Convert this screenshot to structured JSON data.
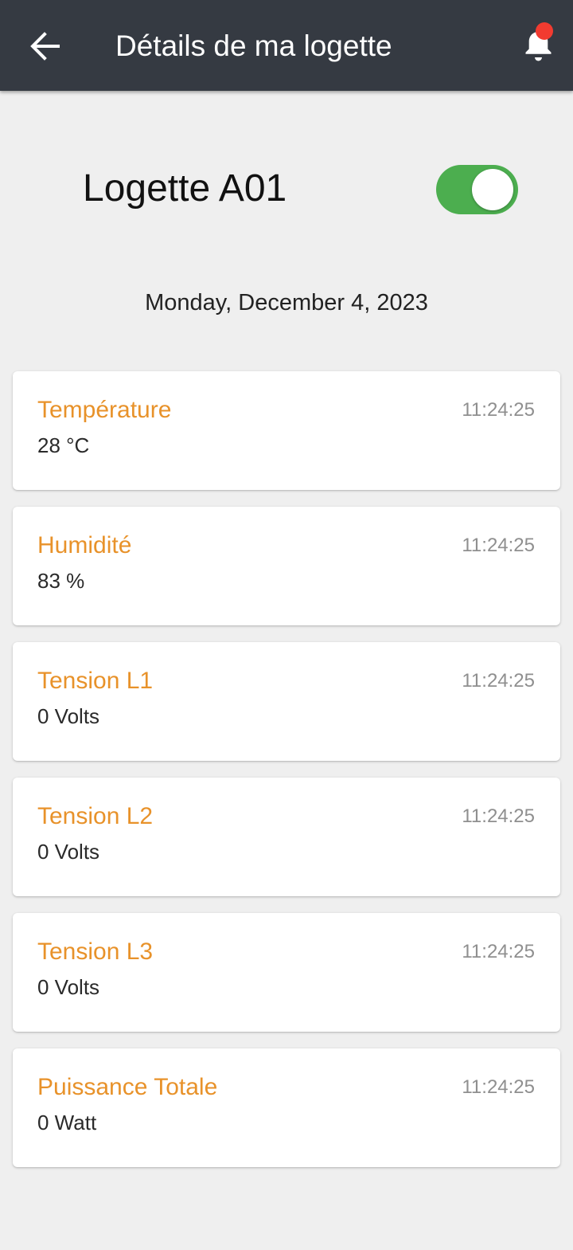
{
  "app_bar": {
    "title": "Détails de ma logette",
    "back_icon": "arrow-left-icon",
    "notification_icon": "bell-icon",
    "notification_badge_color": "#f23b30",
    "background_color": "#353a42"
  },
  "device": {
    "name": "Logette A01",
    "toggle_on": true,
    "toggle_color": "#4cae4f"
  },
  "date": "Monday, December 4, 2023",
  "accent_color": "#e8922a",
  "measurements": [
    {
      "title": "Température",
      "value": "28 °C",
      "time": "11:24:25"
    },
    {
      "title": "Humidité",
      "value": "83 %",
      "time": "11:24:25"
    },
    {
      "title": "Tension L1",
      "value": "0 Volts",
      "time": "11:24:25"
    },
    {
      "title": "Tension L2",
      "value": "0 Volts",
      "time": "11:24:25"
    },
    {
      "title": "Tension L3",
      "value": "0 Volts",
      "time": "11:24:25"
    },
    {
      "title": "Puissance Totale",
      "value": "0 Watt",
      "time": "11:24:25"
    }
  ]
}
